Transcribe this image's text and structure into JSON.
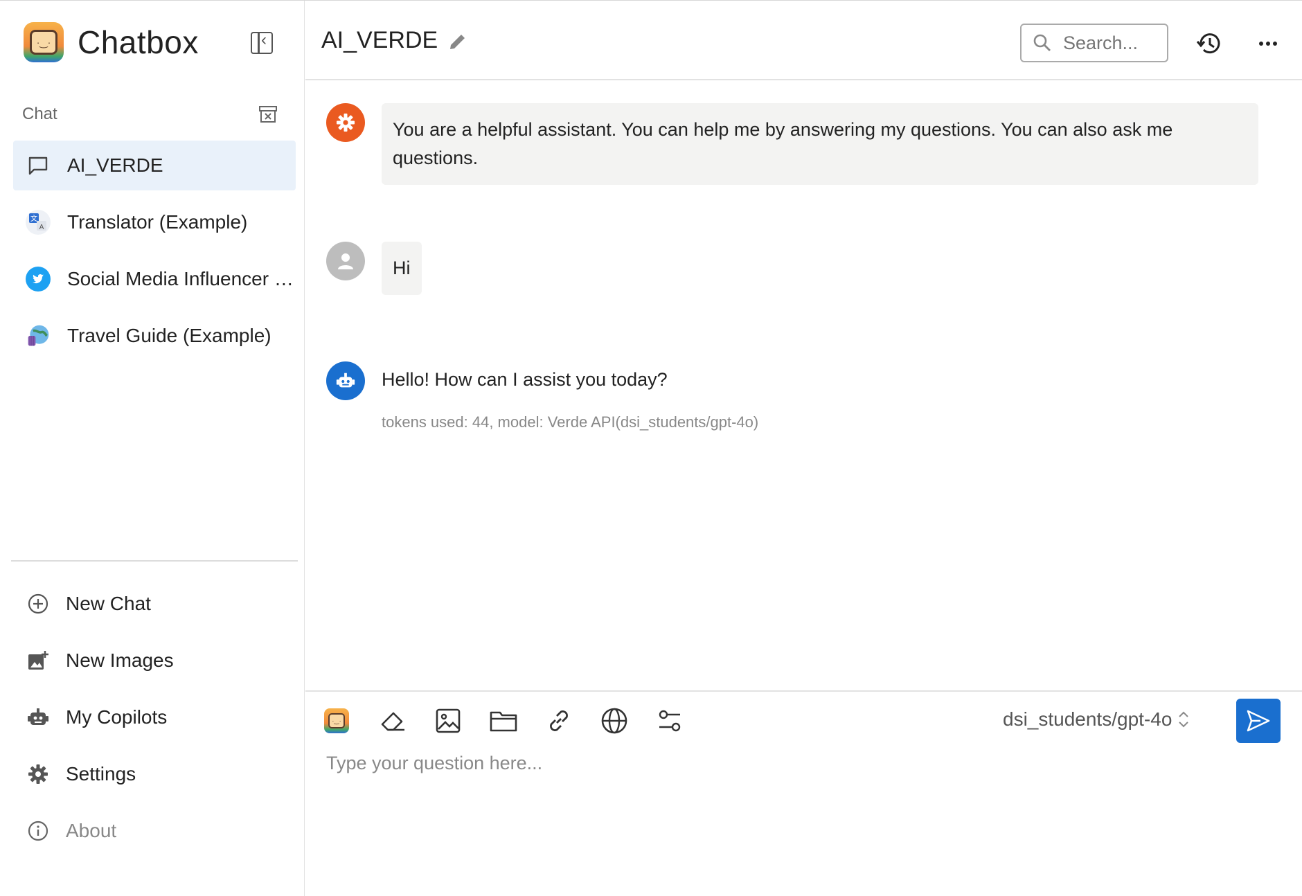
{
  "brand": {
    "title": "Chatbox"
  },
  "sidebar": {
    "section_label": "Chat",
    "chats": [
      {
        "label": "AI_VERDE",
        "icon": "chat-bubble-icon",
        "active": true
      },
      {
        "label": "Translator (Example)",
        "icon": "translate-icon",
        "active": false
      },
      {
        "label": "Social Media Influencer …",
        "icon": "twitter-bird-icon",
        "active": false
      },
      {
        "label": "Travel Guide (Example)",
        "icon": "globe-icon",
        "active": false
      }
    ],
    "nav": [
      {
        "label": "New Chat",
        "icon": "plus-circle-icon"
      },
      {
        "label": "New Images",
        "icon": "add-image-icon"
      },
      {
        "label": "My Copilots",
        "icon": "robot-icon"
      },
      {
        "label": "Settings",
        "icon": "gear-icon"
      },
      {
        "label": "About",
        "icon": "info-icon"
      }
    ]
  },
  "header": {
    "title": "AI_VERDE",
    "search_placeholder": "Search..."
  },
  "messages": [
    {
      "role": "system",
      "text": "You are a helpful assistant. You can help me by answering my questions. You can also ask me questions."
    },
    {
      "role": "user",
      "text": "Hi"
    },
    {
      "role": "assistant",
      "text": "Hello! How can I assist you today?",
      "meta": "tokens used: 44, model: Verde API(dsi_students/gpt-4o)"
    }
  ],
  "composer": {
    "model": "dsi_students/gpt-4o",
    "placeholder": "Type your question here..."
  },
  "colors": {
    "accent": "#1a6fcf",
    "system_avatar": "#ea5a20",
    "user_avatar": "#bdbdbd",
    "assistant_avatar": "#1a6fcf",
    "active_item_bg": "#e9f1fa"
  }
}
